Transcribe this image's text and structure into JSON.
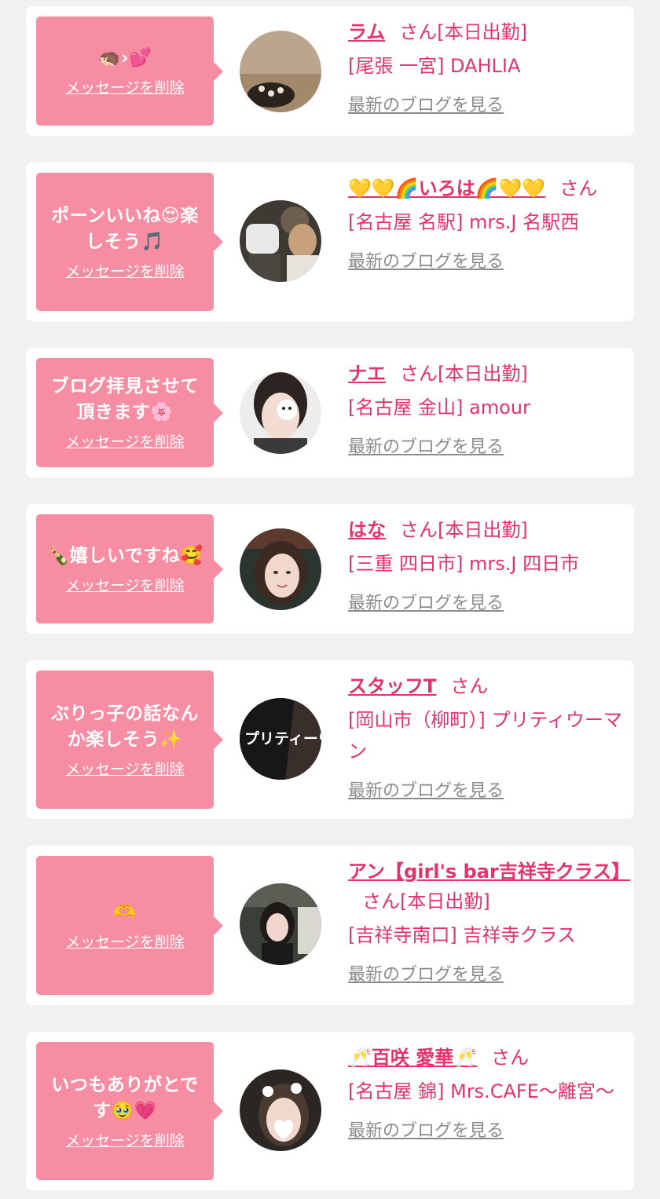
{
  "delete_label": "メッセージを削除",
  "san_label": "さん",
  "blog_label": "最新のブログを見る",
  "colors": {
    "bubble": "#f78da2",
    "accent": "#e2336d",
    "muted": "#8b8b8b",
    "background": "#f1f1f1"
  },
  "messages": [
    {
      "message": "🦔›💕",
      "name": "ラム",
      "status": "[本日出勤]",
      "shop": "[尾張 一宮] DAHLIA"
    },
    {
      "message": "ポーンいいね😍楽しそう🎵",
      "name": "💛💛🌈いろは🌈💛💛",
      "status": "",
      "shop": "[名古屋 名駅] mrs.J 名駅西"
    },
    {
      "message": "ブログ拝見させて頂きます🌸",
      "name": "ナエ",
      "status": "[本日出勤]",
      "shop": "[名古屋 金山] amour"
    },
    {
      "message": "🍾嬉しいですね🥰",
      "name": "はな",
      "status": "[本日出勤]",
      "shop": "[三重 四日市] mrs.J 四日市"
    },
    {
      "message": "ぶりっ子の話なんか楽しそう✨",
      "name": "スタッフT",
      "status": "",
      "shop": "[岡山市（柳町）] プリティウーマン",
      "avatar_text": "プリティーウーマ"
    },
    {
      "message": "🫶",
      "name": "アン【girl's bar吉祥寺クラス】",
      "status": "[本日出勤]",
      "shop": "[吉祥寺南口] 吉祥寺クラス"
    },
    {
      "message": "いつもありがとです🥹💗",
      "name": "🥂百咲 愛華🥂",
      "status": "",
      "shop": "[名古屋 錦] Mrs.CAFE～離宮～"
    }
  ]
}
